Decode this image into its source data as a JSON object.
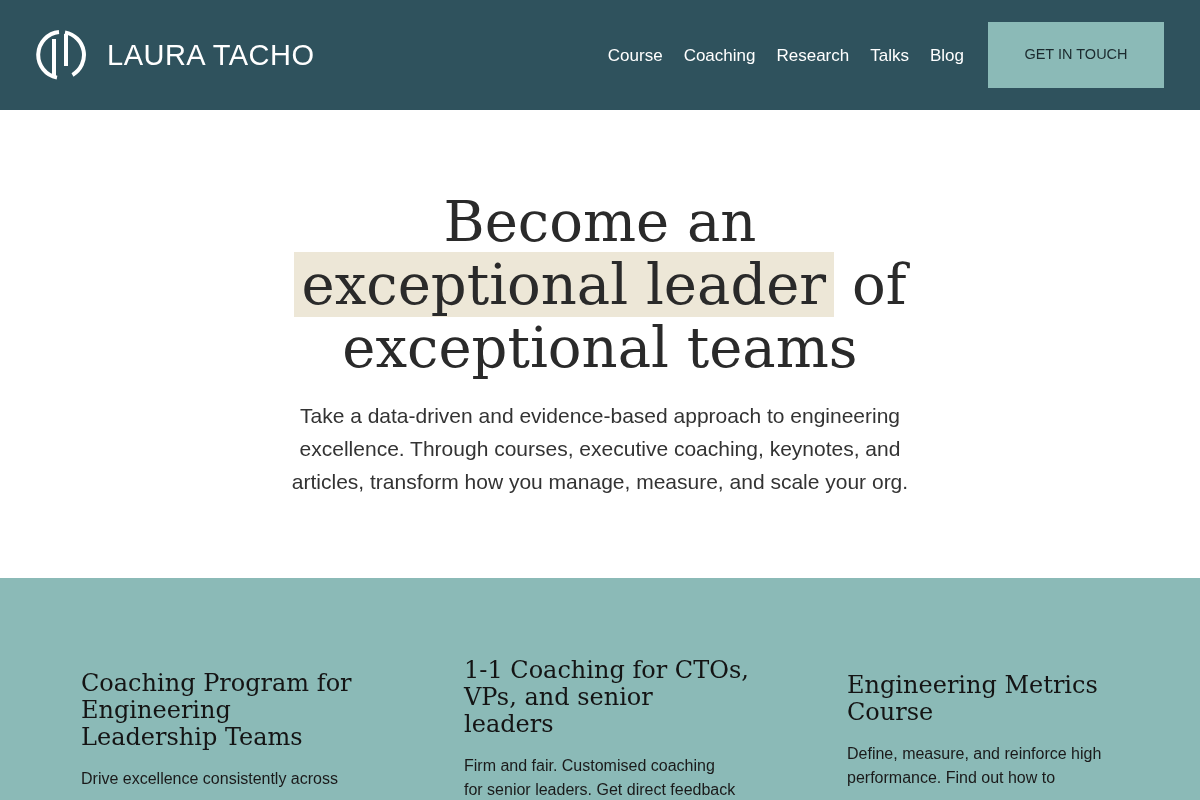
{
  "header": {
    "logo": {
      "text": "LAURA TACHO"
    },
    "nav": [
      {
        "label": "Course"
      },
      {
        "label": "Coaching"
      },
      {
        "label": "Research"
      },
      {
        "label": "Talks"
      },
      {
        "label": "Blog"
      }
    ],
    "cta": {
      "label": "GET IN TOUCH"
    }
  },
  "hero": {
    "heading": {
      "lines": [
        [
          {
            "text": "Become an",
            "highlighted": false
          }
        ],
        [
          {
            "text": "exceptional leader",
            "highlighted": true
          },
          {
            "text": "of",
            "highlighted": false
          }
        ],
        [
          {
            "text": "exceptional teams",
            "highlighted": false
          }
        ]
      ]
    },
    "intro": "Take a data-driven and evidence-based approach to engineering excellence. Through courses, executive coaching, keynotes, and articles, transform how you manage, measure, and scale your org."
  },
  "offerings": [
    {
      "title": "Coaching Program for Engineering Leadership Teams",
      "description": "Drive excellence consistently across"
    },
    {
      "title": "1-1 Coaching for CTOs, VPs, and senior leaders",
      "description": "Firm and fair. Customised coaching for senior leaders. Get direct feedback"
    },
    {
      "title": "Engineering Metrics Course",
      "description": "Define, measure, and reinforce high performance. Find out how to"
    }
  ]
}
